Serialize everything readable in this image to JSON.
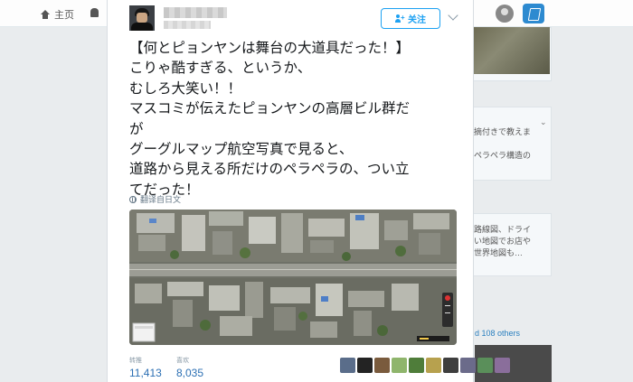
{
  "nav": {
    "home_label": "主页"
  },
  "tweet": {
    "follow_label": "关注",
    "text_lines": [
      "【何とピョンヤンは舞台の大道具だった！】",
      "こりゃ酷すぎる、というか、",
      "むしろ大笑い！！",
      "マスコミが伝えたピョンヤンの高層ビル群だ",
      "が",
      "グーグルマップ航空写真で見ると、",
      "道路から見える所だけのペラペラの、つい立",
      "てだった！"
    ],
    "translate_label": "翻译自日文",
    "retweets_label": "转推",
    "retweets_value": "11,413",
    "likes_label": "喜欢",
    "likes_value": "8,035",
    "liker_colors": [
      "#5a6d8a",
      "#232323",
      "#7a5b3d",
      "#8fb56c",
      "#4f7d3a",
      "#b7a14e",
      "#3e3e3e",
      "#6b6b8a",
      "#5a8f5a",
      "#8a6e9b"
    ]
  },
  "background": {
    "right_lines": [
      "摘付きで教えま",
      "ペラペラ構造の"
    ],
    "map_ad_lines": [
      "路線図、ドライ",
      "い地図でお店や",
      "世界地図も…"
    ],
    "blue_text": "d 108 others"
  }
}
